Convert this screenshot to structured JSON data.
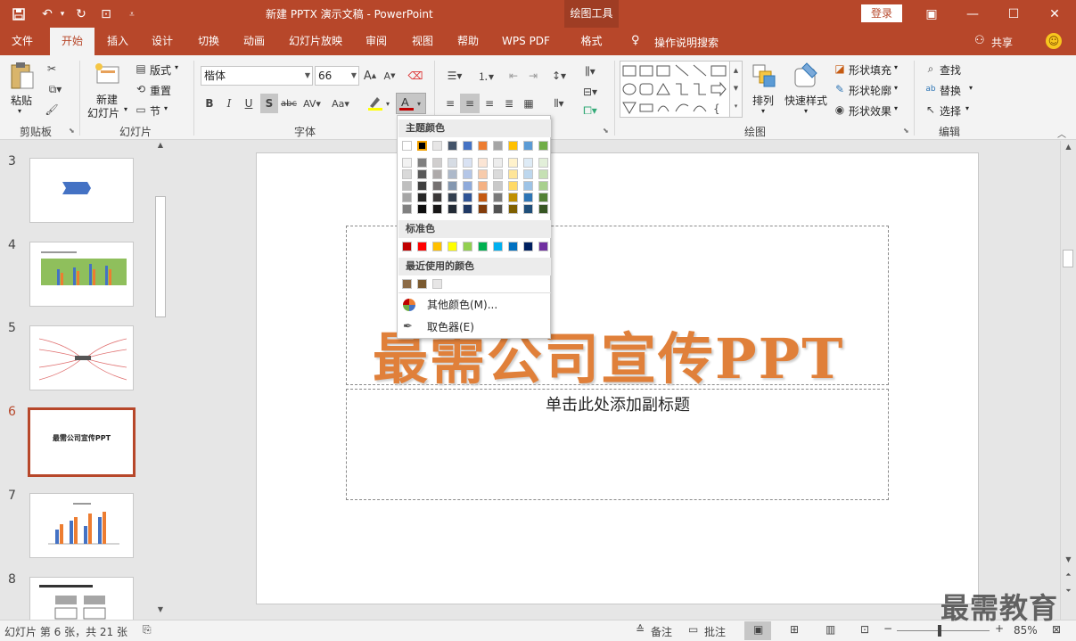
{
  "titlebar": {
    "document_title": "新建 PPTX 演示文稿 - PowerPoint",
    "context_tools": "绘图工具",
    "login": "登录"
  },
  "tabs": [
    "文件",
    "开始",
    "插入",
    "设计",
    "切换",
    "动画",
    "幻灯片放映",
    "审阅",
    "视图",
    "帮助",
    "WPS PDF",
    "格式"
  ],
  "active_tab": "开始",
  "tell_me": "操作说明搜索",
  "share": "共享",
  "ribbon": {
    "clipboard": {
      "paste": "粘贴",
      "group": "剪贴板"
    },
    "slides": {
      "new_slide_1": "新建",
      "new_slide_2": "幻灯片",
      "layout": "版式",
      "reset": "重置",
      "section": "节",
      "group": "幻灯片"
    },
    "font": {
      "font_name": "楷体",
      "font_size": "66",
      "group": "字体"
    },
    "paragraph": {
      "group": ""
    },
    "drawing": {
      "arrange": "排列",
      "quick_styles": "快速样式",
      "fill": "形状填充",
      "outline": "形状轮廓",
      "effects": "形状效果",
      "group": "绘图"
    },
    "editing": {
      "find": "查找",
      "replace": "替换",
      "select": "选择",
      "group": "编辑"
    }
  },
  "color_dropdown": {
    "theme_header": "主题颜色",
    "theme_top": [
      "#ffffff",
      "#000000",
      "#e7e6e6",
      "#44546a",
      "#4472c4",
      "#ed7d31",
      "#a5a5a5",
      "#ffc000",
      "#5b9bd5",
      "#70ad47"
    ],
    "theme_shades": [
      [
        "#f2f2f2",
        "#d9d9d9",
        "#bfbfbf",
        "#a6a6a6",
        "#808080"
      ],
      [
        "#7f7f7f",
        "#595959",
        "#404040",
        "#262626",
        "#0d0d0d"
      ],
      [
        "#d0cece",
        "#aeaaaa",
        "#757171",
        "#3a3838",
        "#171616"
      ],
      [
        "#d6dce4",
        "#adb9ca",
        "#8497b0",
        "#333f4f",
        "#222a35"
      ],
      [
        "#d9e2f3",
        "#b4c6e7",
        "#8eaadb",
        "#2f5496",
        "#1f3864"
      ],
      [
        "#fbe5d5",
        "#f7cbac",
        "#f4b183",
        "#c55a11",
        "#833c0b"
      ],
      [
        "#ededed",
        "#dbdbdb",
        "#c9c9c9",
        "#7b7b7b",
        "#525252"
      ],
      [
        "#fff2cc",
        "#fee599",
        "#ffd966",
        "#bf8f00",
        "#7f6000"
      ],
      [
        "#deebf6",
        "#bdd7ee",
        "#9dc3e6",
        "#2e75b5",
        "#1f4e79"
      ],
      [
        "#e2efd9",
        "#c5e0b3",
        "#a8d08d",
        "#538135",
        "#375623"
      ]
    ],
    "standard_header": "标准色",
    "standard": [
      "#c00000",
      "#ff0000",
      "#ffc000",
      "#ffff00",
      "#92d050",
      "#00b050",
      "#00b0f0",
      "#0070c0",
      "#002060",
      "#7030a0"
    ],
    "recent_header": "最近使用的颜色",
    "recent": [
      "#8b6a46",
      "#7a5a30",
      "#e7e6e6"
    ],
    "more_colors": "其他颜色(M)...",
    "eyedropper": "取色器(E)"
  },
  "thumbnails": [
    {
      "num": "3"
    },
    {
      "num": "4"
    },
    {
      "num": "5"
    },
    {
      "num": "6",
      "text": "最需公司宣传PPT"
    },
    {
      "num": "7"
    },
    {
      "num": "8"
    }
  ],
  "slide": {
    "title": "最需公司宣传PPT",
    "subtitle": "单击此处添加副标题"
  },
  "status": {
    "slide_info": "幻灯片 第 6 张，共 21 张",
    "notes": "备注",
    "comments": "批注",
    "zoom": "85%"
  },
  "watermark": "最需教育"
}
